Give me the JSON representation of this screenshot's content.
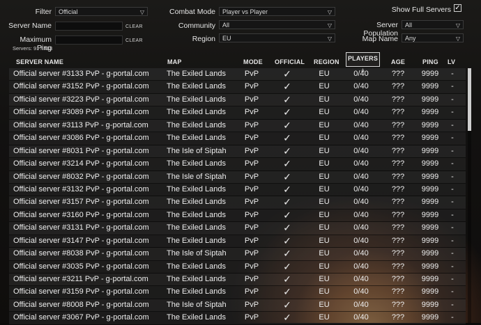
{
  "filters": {
    "filter_label": "Filter",
    "filter_value": "Official",
    "server_name_label": "Server Name",
    "server_name_value": "",
    "max_ping_label": "Maximum Ping",
    "max_ping_value": "",
    "clear_label": "CLEAR",
    "servers_count": "Servers: 91 / 433",
    "combat_mode_label": "Combat Mode",
    "combat_mode_value": "Player vs Player",
    "community_label": "Community",
    "community_value": "All",
    "region_label": "Region",
    "region_value": "EU",
    "show_full_label": "Show Full Servers",
    "show_full_checked": "✓",
    "population_label": "Server Population",
    "population_value": "All",
    "map_name_label": "Map Name",
    "map_name_value": "Any"
  },
  "columns": {
    "server_name": "SERVER NAME",
    "map": "MAP",
    "mode": "MODE",
    "official": "OFFICIAL",
    "region": "REGION",
    "players": "PLAYERS ▲",
    "age": "AGE",
    "ping": "PING",
    "lv": "LV"
  },
  "rows": [
    {
      "name": "Official server #3133 PvP - g-portal.com",
      "map": "The Exiled Lands",
      "mode": "PvP",
      "official": "✓",
      "region": "EU",
      "players": "0/40",
      "age": "???",
      "ping": "9999",
      "lv": "-"
    },
    {
      "name": "Official server #3152 PvP - g-portal.com",
      "map": "The Exiled Lands",
      "mode": "PvP",
      "official": "✓",
      "region": "EU",
      "players": "0/40",
      "age": "???",
      "ping": "9999",
      "lv": "-"
    },
    {
      "name": "Official server #3223 PvP - g-portal.com",
      "map": "The Exiled Lands",
      "mode": "PvP",
      "official": "✓",
      "region": "EU",
      "players": "0/40",
      "age": "???",
      "ping": "9999",
      "lv": "-"
    },
    {
      "name": "Official server #3089 PvP - g-portal.com",
      "map": "The Exiled Lands",
      "mode": "PvP",
      "official": "✓",
      "region": "EU",
      "players": "0/40",
      "age": "???",
      "ping": "9999",
      "lv": "-"
    },
    {
      "name": "Official server #3113 PvP - g-portal.com",
      "map": "The Exiled Lands",
      "mode": "PvP",
      "official": "✓",
      "region": "EU",
      "players": "0/40",
      "age": "???",
      "ping": "9999",
      "lv": "-"
    },
    {
      "name": "Official server #3086 PvP - g-portal.com",
      "map": "The Exiled Lands",
      "mode": "PvP",
      "official": "✓",
      "region": "EU",
      "players": "0/40",
      "age": "???",
      "ping": "9999",
      "lv": "-"
    },
    {
      "name": "Official server #8031 PvP - g-portal.com",
      "map": "The Isle of Siptah",
      "mode": "PvP",
      "official": "✓",
      "region": "EU",
      "players": "0/40",
      "age": "???",
      "ping": "9999",
      "lv": "-"
    },
    {
      "name": "Official server #3214 PvP - g-portal.com",
      "map": "The Exiled Lands",
      "mode": "PvP",
      "official": "✓",
      "region": "EU",
      "players": "0/40",
      "age": "???",
      "ping": "9999",
      "lv": "-"
    },
    {
      "name": "Official server #8032 PvP - g-portal.com",
      "map": "The Isle of Siptah",
      "mode": "PvP",
      "official": "✓",
      "region": "EU",
      "players": "0/40",
      "age": "???",
      "ping": "9999",
      "lv": "-"
    },
    {
      "name": "Official server #3132 PvP - g-portal.com",
      "map": "The Exiled Lands",
      "mode": "PvP",
      "official": "✓",
      "region": "EU",
      "players": "0/40",
      "age": "???",
      "ping": "9999",
      "lv": "-"
    },
    {
      "name": "Official server #3157 PvP - g-portal.com",
      "map": "The Exiled Lands",
      "mode": "PvP",
      "official": "✓",
      "region": "EU",
      "players": "0/40",
      "age": "???",
      "ping": "9999",
      "lv": "-"
    },
    {
      "name": "Official server #3160 PvP - g-portal.com",
      "map": "The Exiled Lands",
      "mode": "PvP",
      "official": "✓",
      "region": "EU",
      "players": "0/40",
      "age": "???",
      "ping": "9999",
      "lv": "-"
    },
    {
      "name": "Official server #3131 PvP - g-portal.com",
      "map": "The Exiled Lands",
      "mode": "PvP",
      "official": "✓",
      "region": "EU",
      "players": "0/40",
      "age": "???",
      "ping": "9999",
      "lv": "-"
    },
    {
      "name": "Official server #3147 PvP - g-portal.com",
      "map": "The Exiled Lands",
      "mode": "PvP",
      "official": "✓",
      "region": "EU",
      "players": "0/40",
      "age": "???",
      "ping": "9999",
      "lv": "-"
    },
    {
      "name": "Official server #8038 PvP - g-portal.com",
      "map": "The Isle of Siptah",
      "mode": "PvP",
      "official": "✓",
      "region": "EU",
      "players": "0/40",
      "age": "???",
      "ping": "9999",
      "lv": "-"
    },
    {
      "name": "Official server #3035 PvP - g-portal.com",
      "map": "The Exiled Lands",
      "mode": "PvP",
      "official": "✓",
      "region": "EU",
      "players": "0/40",
      "age": "???",
      "ping": "9999",
      "lv": "-"
    },
    {
      "name": "Official server #3211 PvP - g-portal.com",
      "map": "The Exiled Lands",
      "mode": "PvP",
      "official": "✓",
      "region": "EU",
      "players": "0/40",
      "age": "???",
      "ping": "9999",
      "lv": "-"
    },
    {
      "name": "Official server #3159 PvP - g-portal.com",
      "map": "The Exiled Lands",
      "mode": "PvP",
      "official": "✓",
      "region": "EU",
      "players": "0/40",
      "age": "???",
      "ping": "9999",
      "lv": "-"
    },
    {
      "name": "Official server #8008 PvP - g-portal.com",
      "map": "The Isle of Siptah",
      "mode": "PvP",
      "official": "✓",
      "region": "EU",
      "players": "0/40",
      "age": "???",
      "ping": "9999",
      "lv": "-"
    },
    {
      "name": "Official server #3067 PvP - g-portal.com",
      "map": "The Exiled Lands",
      "mode": "PvP",
      "official": "✓",
      "region": "EU",
      "players": "0/40",
      "age": "???",
      "ping": "9999",
      "lv": "-"
    }
  ]
}
